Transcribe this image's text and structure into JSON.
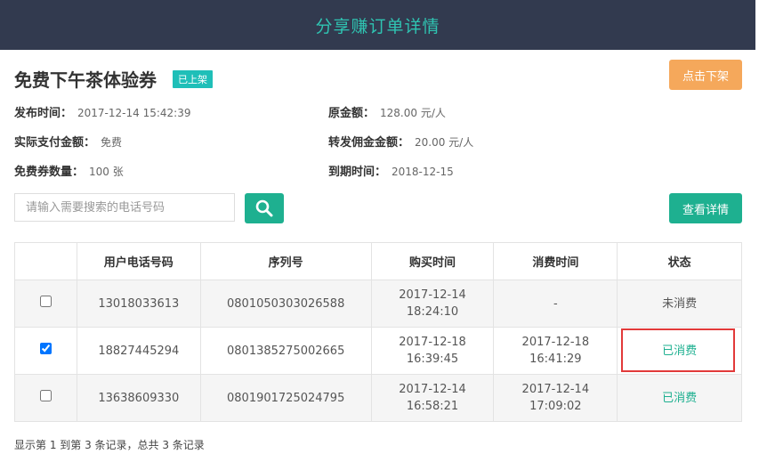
{
  "header": {
    "title": "分享赚订单详情"
  },
  "coupon": {
    "name": "免费下午茶体验券",
    "status_badge": "已上架",
    "unlist_label": "点击下架"
  },
  "info": {
    "publish_time_label": "发布时间：",
    "publish_time": "2017-12-14 15:42:39",
    "orig_price_label": "原金额：",
    "orig_price": "128.00 元/人",
    "actual_pay_label": "实际支付金额：",
    "actual_pay": "免费",
    "commission_label": "转发佣金金额：",
    "commission": "20.00 元/人",
    "free_count_label": "免费券数量：",
    "free_count": "100 张",
    "expire_label": "到期时间：",
    "expire": "2018-12-15"
  },
  "search": {
    "placeholder": "请输入需要搜索的电话号码",
    "value": ""
  },
  "detail_button": "查看详情",
  "table": {
    "headers": [
      "",
      "用户电话号码",
      "序列号",
      "购买时间",
      "消费时间",
      "状态"
    ],
    "rows": [
      {
        "checked": false,
        "phone": "13018033613",
        "serial": "0801050303026588",
        "buy_date": "2017-12-14",
        "buy_time": "18:24:10",
        "use_date": "-",
        "use_time": "",
        "status": "未消费"
      },
      {
        "checked": true,
        "phone": "18827445294",
        "serial": "0801385275002665",
        "buy_date": "2017-12-18",
        "buy_time": "16:39:45",
        "use_date": "2017-12-18",
        "use_time": "16:41:29",
        "status": "已消费"
      },
      {
        "checked": false,
        "phone": "13638609330",
        "serial": "0801901725024795",
        "buy_date": "2017-12-14",
        "buy_time": "16:58:21",
        "use_date": "2017-12-14",
        "use_time": "17:09:02",
        "status": "已消费"
      }
    ]
  },
  "footer": "显示第 1 到第 3 条记录，总共 3 条记录",
  "colors": {
    "header_bg": "#323a4f",
    "accent": "#1eb090",
    "orange": "#f5a85b",
    "highlight": "#e23a3a"
  }
}
